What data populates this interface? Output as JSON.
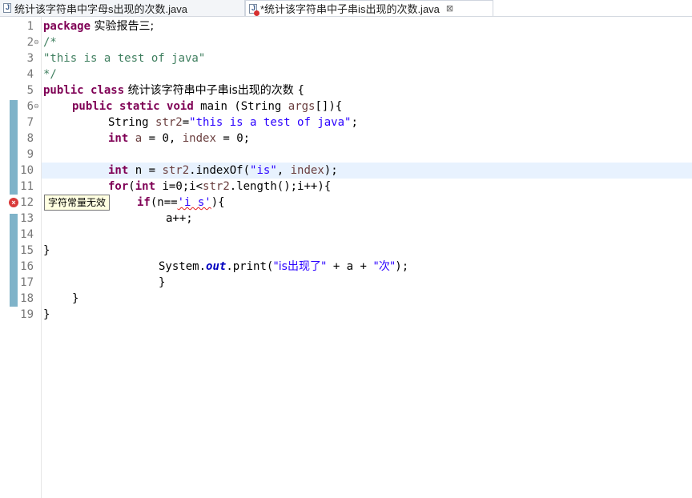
{
  "tabs": [
    {
      "label": "统计该字符串中字母s出现的次数.java",
      "active": false,
      "dirty": false
    },
    {
      "label": "*统计该字符串中子串is出现的次数.java",
      "active": true,
      "dirty": true,
      "close": "⊠"
    }
  ],
  "editor": {
    "line_numbers": [
      "1",
      "2",
      "3",
      "4",
      "5",
      "6",
      "7",
      "8",
      "9",
      "10",
      "11",
      "12",
      "13",
      "14",
      "15",
      "16",
      "17",
      "18",
      "19"
    ],
    "fold_markers": {
      "2": "⊖",
      "6": "⊖"
    },
    "current_line": 10,
    "error_line": 12,
    "tooltip": "字符常量无效",
    "code": {
      "l1": {
        "kw": "package",
        "rest": " 实验报告三;"
      },
      "l2": "/*",
      "l3": "\"this is a test of java\"",
      "l4": "*/",
      "l5": {
        "kw1": "public",
        "kw2": "class",
        "rest": " 统计该字符串中子串is出现的次数 {"
      },
      "l6": {
        "kw1": "public",
        "kw2": "static",
        "kw3": "void",
        "mid": " main (String ",
        "arg": "args",
        "rest": "[]){"
      },
      "l7": {
        "a": "String ",
        "var": "str2",
        "b": "=",
        "str": "\"this is a test of java\"",
        "c": ";"
      },
      "l8": {
        "kw": "int",
        "a": " ",
        "v1": "a",
        "b": " = 0, ",
        "v2": "index",
        "c": " = 0;"
      },
      "l10": {
        "kw": "int",
        "a": " n = ",
        "var": "str2",
        "b": ".indexOf(",
        "str": "\"is\"",
        "c": ", ",
        "v2": "index",
        "d": ");"
      },
      "l11": {
        "kw1": "for",
        "a": "(",
        "kw2": "int",
        "b": " i=0;i<",
        "var": "str2",
        "c": ".length();i++){"
      },
      "l12": {
        "kw": "if",
        "a": "(n==",
        "err": "'i s'",
        "b": "){"
      },
      "l13": "a++;",
      "l15": "}",
      "l16": {
        "a": "System.",
        "fld": "out",
        "b": ".print(",
        "str1": "\"is出现了\"",
        "c": " + a + ",
        "str2": "\"次\"",
        "d": ");"
      },
      "l17": "}",
      "l18": "}",
      "l19": "}"
    }
  },
  "colors": {
    "keyword": "#7f0055",
    "string": "#2a00ff",
    "comment": "#3f7f5f",
    "current_line": "#e8f2fe",
    "error": "#d93a3a"
  }
}
